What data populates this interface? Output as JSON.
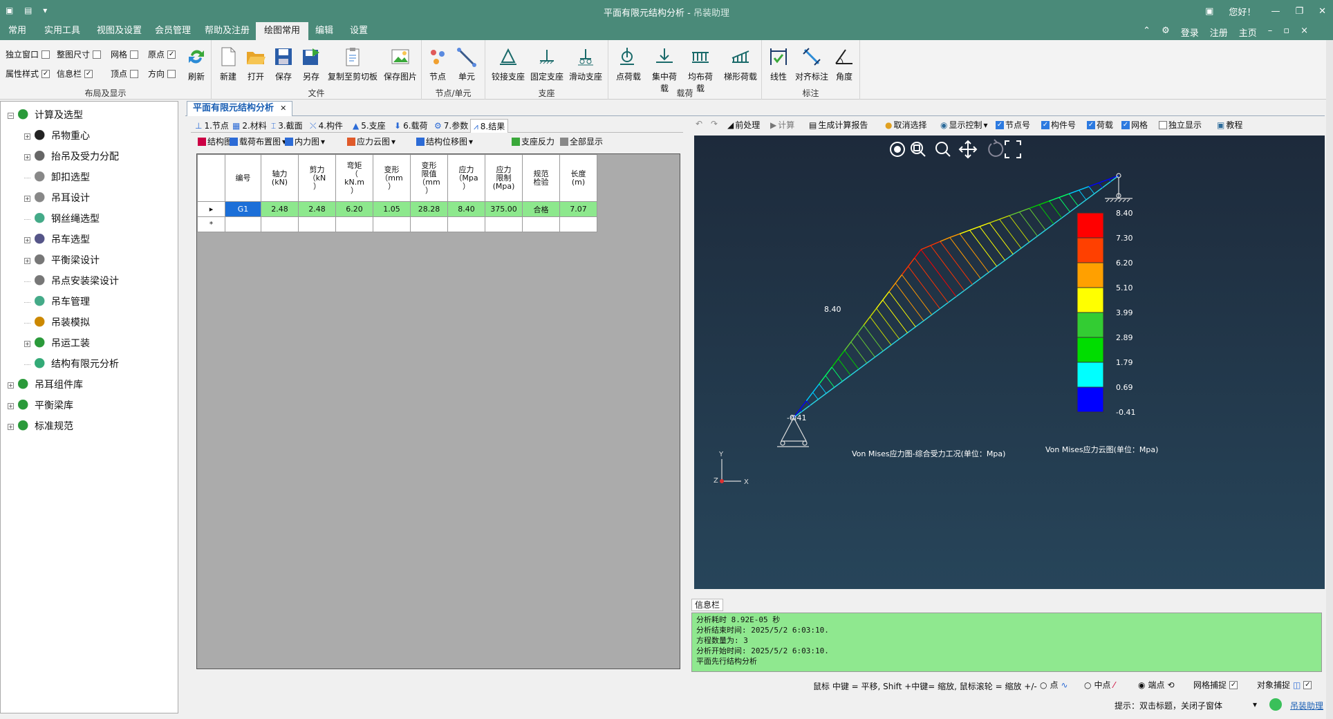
{
  "window": {
    "title": "平面有限元结构分析",
    "subtitle": "吊装助理",
    "hello": "您好！",
    "min": "—",
    "restore": "❐",
    "close": "✕"
  },
  "menu": {
    "tabs": [
      "常用",
      "实用工具",
      "视图及设置",
      "会员管理",
      "帮助及注册",
      "绘图常用",
      "编辑",
      "设置"
    ],
    "active": 5,
    "right": {
      "login": "登录",
      "register": "注册",
      "home": "主页"
    }
  },
  "ribbon": {
    "layout": {
      "label": "布局及显示",
      "options": [
        {
          "label": "独立窗口",
          "checked": false
        },
        {
          "label": "整图尺寸",
          "checked": false
        },
        {
          "label": "网格",
          "checked": false
        },
        {
          "label": "原点",
          "checked": true
        },
        {
          "label": "属性样式",
          "checked": true
        },
        {
          "label": "信息栏",
          "checked": true
        },
        {
          "label": "顶点",
          "checked": false
        },
        {
          "label": "方向",
          "checked": false
        }
      ],
      "refresh": "刷新"
    },
    "file": {
      "label": "文件",
      "buttons": [
        "新建",
        "打开",
        "保存",
        "另存",
        "复制至剪切板",
        "保存图片"
      ]
    },
    "node": {
      "label": "节点/单元",
      "buttons": [
        "节点",
        "单元"
      ]
    },
    "support": {
      "label": "支座",
      "buttons": [
        "铰接支座",
        "固定支座",
        "滑动支座"
      ]
    },
    "load": {
      "label": "载荷",
      "buttons": [
        "点荷载",
        "集中荷载",
        "均布荷载",
        "梯形荷载"
      ]
    },
    "annot": {
      "label": "标注",
      "buttons": [
        "线性",
        "对齐标注",
        "角度"
      ]
    }
  },
  "tree": {
    "items": [
      {
        "label": "计算及选型",
        "level": 0,
        "exp": "−",
        "color": "#2a9a3a"
      },
      {
        "label": "吊物重心",
        "level": 1,
        "exp": "+",
        "color": "#222"
      },
      {
        "label": "抬吊及受力分配",
        "level": 1,
        "exp": "+",
        "color": "#666"
      },
      {
        "label": "卸扣选型",
        "level": 1,
        "exp": "",
        "color": "#888"
      },
      {
        "label": "吊耳设计",
        "level": 1,
        "exp": "+",
        "color": "#888"
      },
      {
        "label": "钢丝绳选型",
        "level": 1,
        "exp": "",
        "color": "#4a8"
      },
      {
        "label": "吊车选型",
        "level": 1,
        "exp": "+",
        "color": "#558"
      },
      {
        "label": "平衡梁设计",
        "level": 1,
        "exp": "+",
        "color": "#777"
      },
      {
        "label": "吊点安装梁设计",
        "level": 1,
        "exp": "",
        "color": "#777"
      },
      {
        "label": "吊车管理",
        "level": 1,
        "exp": "",
        "color": "#4a8"
      },
      {
        "label": "吊装模拟",
        "level": 1,
        "exp": "",
        "color": "#c80"
      },
      {
        "label": "吊运工装",
        "level": 1,
        "exp": "+",
        "color": "#2a9a3a"
      },
      {
        "label": "结构有限元分析",
        "level": 1,
        "exp": "",
        "color": "#3a7"
      },
      {
        "label": "吊耳组件库",
        "level": 0,
        "exp": "+",
        "color": "#2a9a3a"
      },
      {
        "label": "平衡梁库",
        "level": 0,
        "exp": "+",
        "color": "#2a9a3a"
      },
      {
        "label": "标准规范",
        "level": 0,
        "exp": "+",
        "color": "#2a9a3a"
      }
    ]
  },
  "doc": {
    "tab": "平面有限元结构分析",
    "close": "✕"
  },
  "subtabs": [
    "1.节点",
    "2.材料",
    "3.截面",
    "4.构件",
    "5.支座",
    "6.载荷",
    "7.参数",
    "8.结果"
  ],
  "subtool": [
    "结构图",
    "载荷布置图",
    "内力图",
    "应力云图",
    "结构位移图",
    "支座反力",
    "全部显示"
  ],
  "table": {
    "headers": [
      "编号",
      "轴力\n(kN)",
      "剪力\n（kN\n）",
      "弯矩\n（\nkN.m\n）",
      "变形\n（mm\n）",
      "变形\n限值\n（mm\n）",
      "应力\n（Mpa\n）",
      "应力\n限制\n(Mpa)",
      "规范\n检验",
      "长度\n(m)"
    ],
    "rows": [
      [
        "G1",
        "2.48",
        "2.48",
        "6.20",
        "1.05",
        "28.28",
        "8.40",
        "375.00",
        "合格",
        "7.07"
      ]
    ],
    "newrow": "*"
  },
  "righttool": {
    "preprocess": "前处理",
    "compute": "计算",
    "report": "生成计算报告",
    "cancel": "取消选择",
    "display": "显示控制",
    "nodeno": "节点号",
    "memberno": "构件号",
    "load": "荷载",
    "grid": "网格",
    "standalone": "独立显示",
    "tutorial": "教程"
  },
  "viewport": {
    "label_top": "8.40",
    "label_bottom": "-0.41",
    "caption": "Von Mises应力图-综合受力工况(单位：Mpa)",
    "legend_title": "Von Mises应力云图(单位：Mpa)",
    "legend": [
      {
        "v": "8.40",
        "c": "#ff0000"
      },
      {
        "v": "7.30",
        "c": "#ff4000"
      },
      {
        "v": "6.20",
        "c": "#ffa000"
      },
      {
        "v": "5.10",
        "c": "#ffff00"
      },
      {
        "v": "3.99",
        "c": "#33cc33"
      },
      {
        "v": "2.89",
        "c": "#00dd00"
      },
      {
        "v": "1.79",
        "c": "#00ffff"
      },
      {
        "v": "0.69",
        "c": "#0000ff"
      },
      {
        "v": "-0.41",
        "c": ""
      }
    ],
    "axis_x": "X",
    "axis_y": "Y",
    "axis_z": "Z"
  },
  "info": {
    "header": "信息栏",
    "lines": [
      "分析耗时 8.92E-05 秒",
      "分析结束时间: 2025/5/2 6:03:10.",
      "方程数量为: 3",
      "分析开始时间: 2025/5/2 6:03:10.",
      "平面先行结构分析"
    ]
  },
  "status": {
    "hint": "鼠标 中键 = 平移, Shift +中键= 缩放, 鼠标滚轮 = 缩放 +/-",
    "point": "点",
    "midpoint": "中点",
    "endpoint": "端点",
    "gridsnap": "网格捕捉",
    "objsnap": "对象捕捉"
  },
  "bottom": {
    "tip": "提示：双击标题，关闭子窗体",
    "app": "吊装助理"
  }
}
